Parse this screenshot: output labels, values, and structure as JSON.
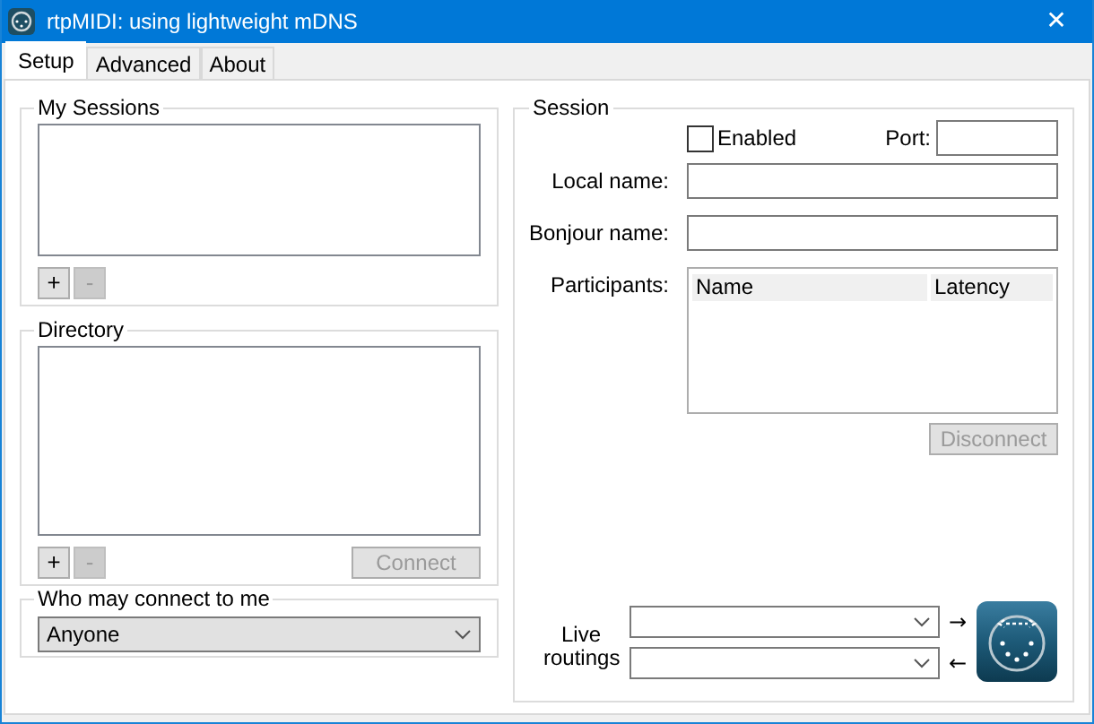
{
  "window": {
    "title": "rtpMIDI: using lightweight mDNS",
    "close": "✕"
  },
  "tabs": [
    {
      "label": "Setup",
      "selected": true
    },
    {
      "label": "Advanced",
      "selected": false
    },
    {
      "label": "About",
      "selected": false
    }
  ],
  "my_sessions": {
    "title": "My Sessions",
    "buttons": [
      {
        "label": "+",
        "disabled": false
      },
      {
        "label": "-",
        "disabled": true
      }
    ]
  },
  "directory": {
    "title": "Directory",
    "buttons": [
      {
        "label": "+",
        "disabled": false
      },
      {
        "label": "-",
        "disabled": true
      }
    ],
    "connect": {
      "label": "Connect",
      "disabled": true
    }
  },
  "who_may_connect": {
    "title": "Who may connect to me",
    "value": "Anyone"
  },
  "session": {
    "title": "Session",
    "enabled": {
      "label": "Enabled",
      "checked": false
    },
    "port_label": "Port:",
    "local_name_label": "Local name:",
    "bonjour_name_label": "Bonjour name:",
    "participants_label": "Participants:",
    "columns": [
      "Name",
      "Latency"
    ],
    "disconnect": {
      "label": "Disconnect",
      "disabled": true
    },
    "live_routings_label": "Live routings",
    "arrows": [
      "→",
      "←"
    ]
  }
}
